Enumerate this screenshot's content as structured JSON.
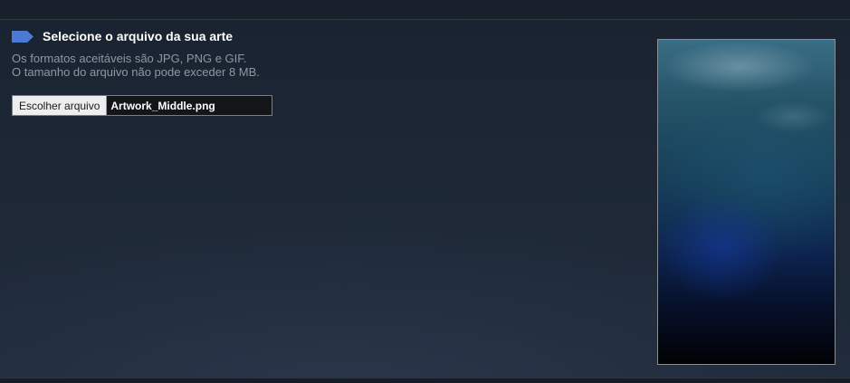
{
  "upload_section": {
    "title": "Selecione o arquivo da sua arte",
    "icon": "tag-icon",
    "accent_color": "#4a7ad2",
    "requirements": [
      "Os formatos aceitáveis são JPG, PNG e GIF.",
      "O tamanho do arquivo não pode exceder 8 MB."
    ]
  },
  "file_input": {
    "button_label": "Escolher arquivo",
    "selected_file": "Artwork_Middle.png"
  }
}
